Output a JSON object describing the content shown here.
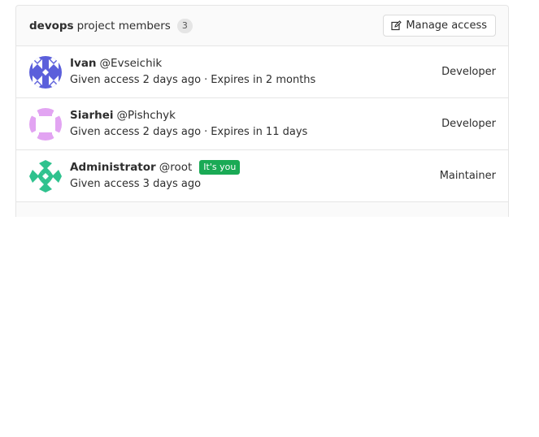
{
  "header": {
    "project_name": "devops",
    "title_rest": "project members",
    "member_count": "3",
    "manage_button_label": "Manage access"
  },
  "members": [
    {
      "name": "Ivan",
      "username": "@Evseichik",
      "given_access": "Given access 2 days ago",
      "separator": "·",
      "expires": "Expires in 2 months",
      "role": "Developer",
      "avatar_color": "#5b5fdb"
    },
    {
      "name": "Siarhei",
      "username": "@Pishchyk",
      "given_access": "Given access 2 days ago",
      "separator": "·",
      "expires": "Expires in 11 days",
      "role": "Developer",
      "avatar_color": "#e2a4f2"
    },
    {
      "name": "Administrator",
      "username": "@root",
      "you_badge": "It's you",
      "given_access": "Given access 3 days ago",
      "role": "Maintainer",
      "avatar_color": "#2fc28e"
    }
  ],
  "colors": {
    "badge_green": "#1aaa55",
    "border": "#e5e5e5",
    "header_bg": "#fafafa"
  }
}
